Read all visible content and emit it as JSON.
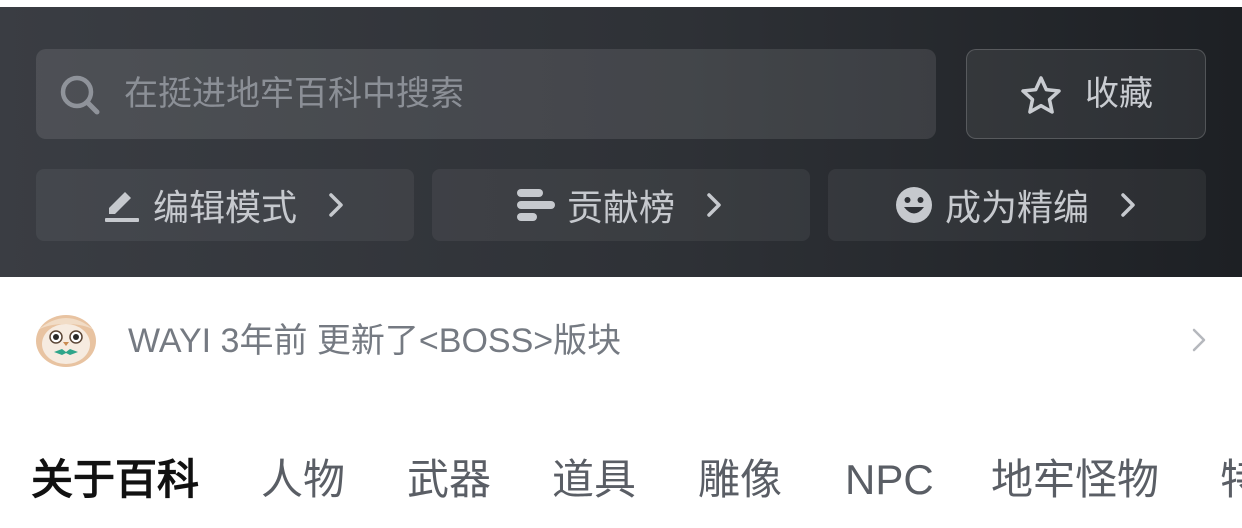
{
  "search": {
    "placeholder": "在挺进地牢百科中搜索",
    "icon": "search-icon"
  },
  "favorite": {
    "label": "收藏",
    "icon": "star-icon"
  },
  "actions": [
    {
      "label": "编辑模式",
      "icon": "pencil-icon"
    },
    {
      "label": "贡献榜",
      "icon": "ranking-bars-icon"
    },
    {
      "label": "成为精编",
      "icon": "smiley-icon"
    }
  ],
  "update": {
    "text": "WAYI 3年前 更新了<BOSS>版块",
    "avatar": "owl-avatar"
  },
  "tabs": [
    {
      "label": "关于百科",
      "active": true
    },
    {
      "label": "人物"
    },
    {
      "label": "武器"
    },
    {
      "label": "道具"
    },
    {
      "label": "雕像"
    },
    {
      "label": "NPC"
    },
    {
      "label": "地牢怪物"
    },
    {
      "label": "特"
    }
  ],
  "colors": {
    "header_dark": "#2e3136",
    "header_text": "#c6c9ce",
    "active_tab": "#111111",
    "inactive_tab": "#5a5e65"
  }
}
